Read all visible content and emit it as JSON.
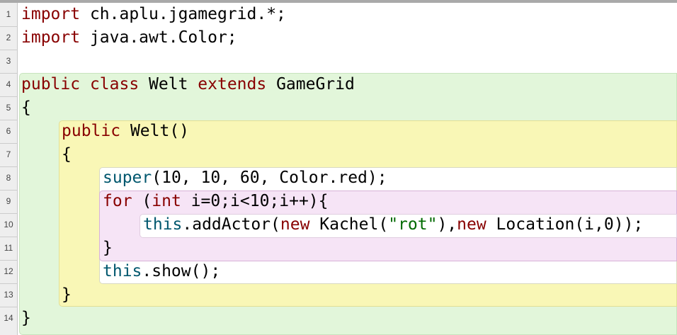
{
  "editor": {
    "line_numbers": [
      "1",
      "2",
      "3",
      "4",
      "5",
      "6",
      "7",
      "8",
      "9",
      "10",
      "11",
      "12",
      "13",
      "14"
    ],
    "code": {
      "l1": {
        "kw": "import",
        "rest": " ch.aplu.jgamegrid.*;"
      },
      "l2": {
        "kw": "import",
        "rest": " java.awt.Color;"
      },
      "l4": {
        "kw_public": "public",
        "kw_class": " class",
        "name": " Welt",
        "kw_extends": " extends",
        "parent": " GameGrid"
      },
      "l5": {
        "text": "{"
      },
      "l6": {
        "kw": "public",
        "rest": " Welt()"
      },
      "l7": {
        "text": "{"
      },
      "l8": {
        "fn": "super",
        "rest": "(10, 10, 60, Color.red);"
      },
      "l9": {
        "kw_for": "for",
        "p1": " (",
        "kw_int": "int",
        "rest": " i=0;i<10;i++){"
      },
      "l10": {
        "fn": "this",
        "p1": ".addActor(",
        "kw_new1": "new",
        "p2": " Kachel(",
        "str": "\"rot\"",
        "p3": "),",
        "kw_new2": "new",
        "p4": " Location(i,0));"
      },
      "l11": {
        "text": "}"
      },
      "l12": {
        "fn": "this",
        "rest": ".show();"
      },
      "l13": {
        "text": "}"
      },
      "l14": {
        "text": "}"
      }
    }
  },
  "colors": {
    "keyword": "#880000",
    "builtin": "#00576e",
    "string": "#006a00",
    "class_scope": "#e2f6da",
    "method_scope": "#f9f7b6",
    "loop_scope": "#f6e4f6"
  }
}
